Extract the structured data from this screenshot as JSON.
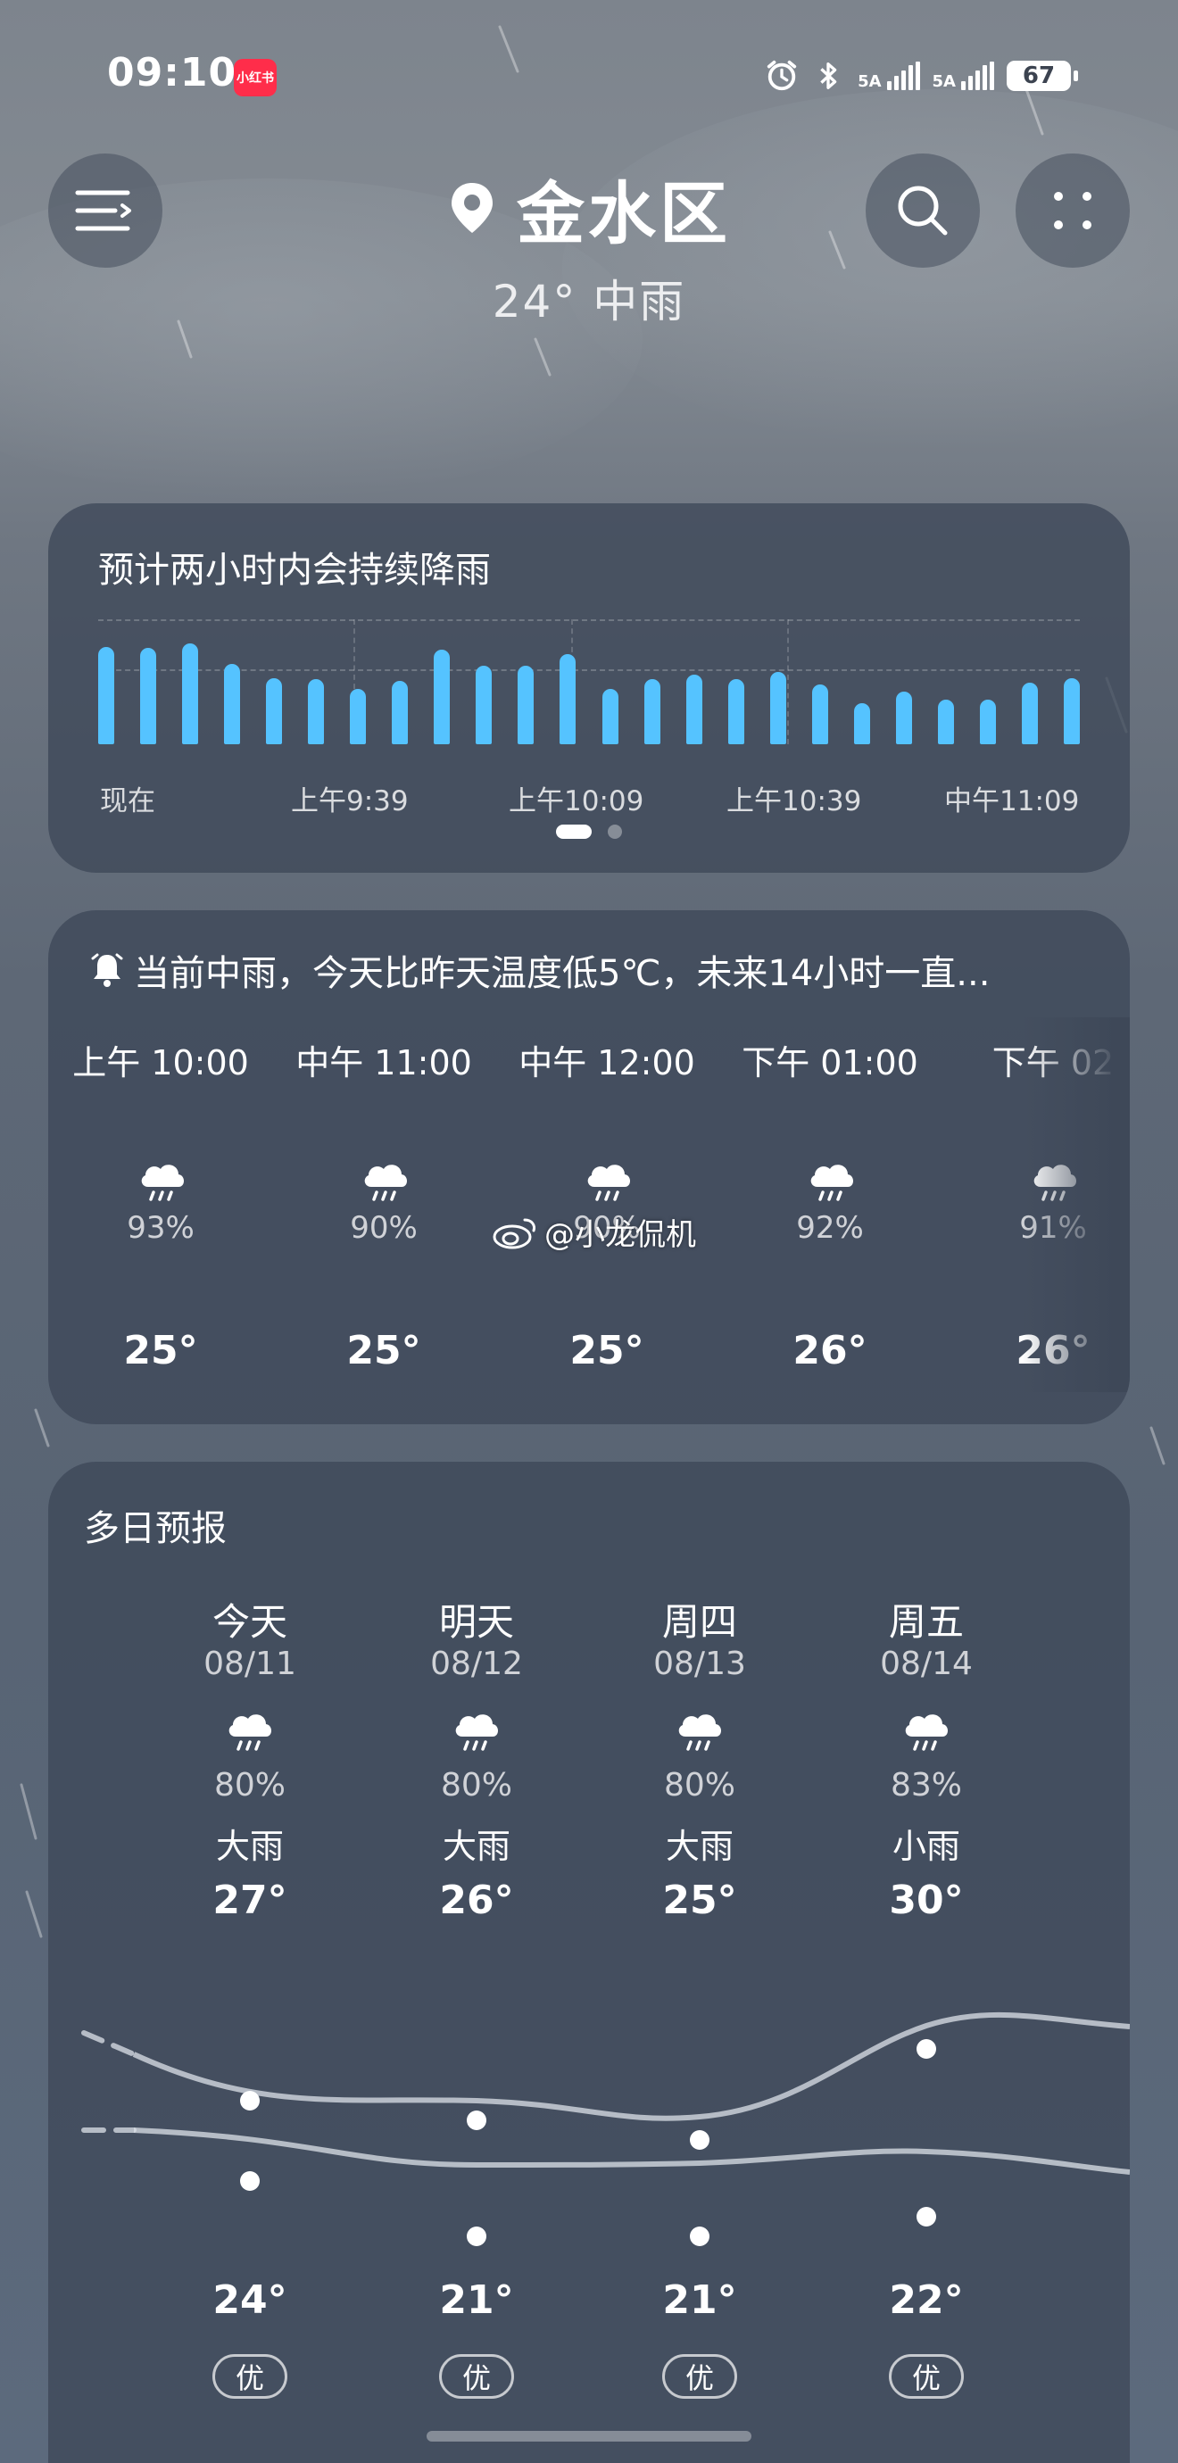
{
  "status_bar": {
    "time": "09:10",
    "app_badge": "小红书",
    "net1_label": "5A",
    "net2_label": "5A",
    "battery": "67"
  },
  "header": {
    "location": "金水区",
    "current": "24° 中雨"
  },
  "precip": {
    "title": "预计两小时内会持续降雨",
    "axis_labels": [
      "现在",
      "上午9:39",
      "上午10:09",
      "上午10:39",
      "中午11:09"
    ],
    "bar_levels": [
      0.78,
      0.77,
      0.81,
      0.64,
      0.53,
      0.52,
      0.44,
      0.51,
      0.76,
      0.63,
      0.63,
      0.72,
      0.44,
      0.52,
      0.56,
      0.52,
      0.58,
      0.48,
      0.33,
      0.42,
      0.36,
      0.36,
      0.49,
      0.53
    ]
  },
  "hourly": {
    "notice": "当前中雨，今天比昨天温度低5℃，未来14小时一直...",
    "items": [
      {
        "time": "上午 10:00",
        "pct": "93%",
        "temp": "25°"
      },
      {
        "time": "中午 11:00",
        "pct": "90%",
        "temp": "25°"
      },
      {
        "time": "中午 12:00",
        "pct": "90%",
        "temp": "25°"
      },
      {
        "time": "下午 01:00",
        "pct": "92%",
        "temp": "26°"
      },
      {
        "time": "下午 02",
        "pct": "91%",
        "temp": "26°"
      }
    ]
  },
  "watermark": "@小龙侃机",
  "daily": {
    "title": "多日预报",
    "days": [
      {
        "name": "今天",
        "date": "08/11",
        "pct": "80%",
        "cond": "大雨",
        "high": "27°",
        "low": "24°",
        "aqi": "优"
      },
      {
        "name": "明天",
        "date": "08/12",
        "pct": "80%",
        "cond": "大雨",
        "high": "26°",
        "low": "21°",
        "aqi": "优"
      },
      {
        "name": "周四",
        "date": "08/13",
        "pct": "80%",
        "cond": "大雨",
        "high": "25°",
        "low": "21°",
        "aqi": "优"
      },
      {
        "name": "周五",
        "date": "08/14",
        "pct": "83%",
        "cond": "小雨",
        "high": "30°",
        "low": "22°",
        "aqi": "优"
      }
    ]
  },
  "colors": {
    "rain_bar": "#55c3ff",
    "card": "#3e4858"
  }
}
